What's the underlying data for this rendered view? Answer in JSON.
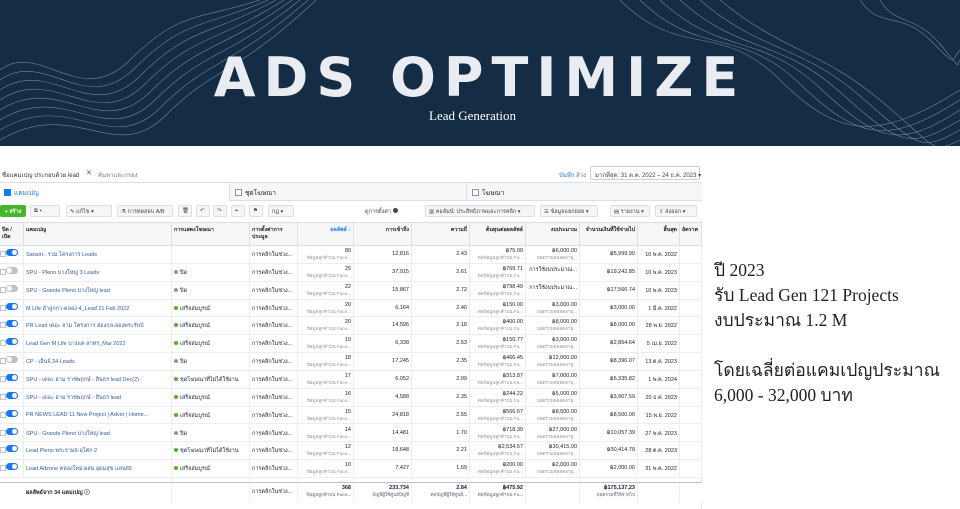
{
  "banner": {
    "title": "ADS OPTIMIZE",
    "subtitle": "Lead Generation"
  },
  "filterbar": {
    "filter_text": "ชื่อแคมเปญ ประกอบด้วย lead",
    "search_placeholder": "ค้นหาและกรอง",
    "save_label": "บันทึก",
    "clear_label": "ล้าง",
    "date_range": "มากที่สุด: 31 ต.ค. 2022 – 24 ธ.ค. 2023"
  },
  "levels": {
    "campaigns": "แคมเปญ",
    "adsets": "ชุดโฆษณา",
    "ads": "โฆษณา"
  },
  "toolbar": {
    "create": "+ สร้าง",
    "edit": "แก้ไข",
    "ab_test": "การทดสอบ A/B",
    "rules": "กฎ",
    "view_setup": "ดูการตั้งค่า",
    "columns": "คอลัมน์: ประสิทธิภาพและการคลิก",
    "breakdown": "ข้อมูลแยกย่อย",
    "reports": "รายงาน",
    "export": "ส่งออก"
  },
  "table": {
    "headers": [
      "ปิด / เปิด",
      "แคมเปญ",
      "การแสดงโฆษณา",
      "การตั้งค่าการประมูล",
      "ผลลัพธ์",
      "การเข้าถึง",
      "ความถี่",
      "ต้นทุนต่อผลลัพธ์",
      "งบประมาณ",
      "จำนวนเงินที่ใช้จ่ายไป",
      "สิ้นสุด",
      "อัตราค"
    ],
    "rows": [
      {
        "on": true,
        "name": "Sansiri - รวม โครงการ Leads",
        "delivery": "",
        "bid": "การคลิกในช่วง...",
        "results": "80",
        "results_sub": "ข้อมูลลูกค้าบน Face...",
        "reach": "12,816",
        "freq": "2.43",
        "cpr": "฿75.00",
        "cpr_sub": "ต่อข้อมูลลูกค้าบน Fa...",
        "budget": "฿6,000.00",
        "budget_sub": "ยอดรวมตลอดอายุ...",
        "spent": "฿5,999.90",
        "end": "10 พ.ค. 2022"
      },
      {
        "on": false,
        "name": "SPU - Pleno บางใหญ่ 3 Leads",
        "delivery": "ปิด",
        "bid": "การคลิกในช่วง...",
        "results": "25",
        "results_sub": "ข้อมูลลูกค้าบน Face...",
        "reach": "37,915",
        "freq": "2.61",
        "cpr": "฿769.71",
        "cpr_sub": "ต่อข้อมูลลูกค้าบน Fa...",
        "budget": "การใช้งบประมาณ...",
        "budget_sub": "",
        "spent": "฿19,242.85",
        "end": "10 พ.ค. 2023"
      },
      {
        "on": false,
        "name": "SPU - Grande Pleno บางใหญ่ lead",
        "delivery": "ปิด",
        "bid": "การคลิกในช่วง...",
        "results": "22",
        "results_sub": "ข้อมูลลูกค้าบน Face...",
        "reach": "15,867",
        "freq": "2.72",
        "cpr": "฿798.49",
        "cpr_sub": "ต่อข้อมูลลูกค้าบน Fa...",
        "budget": "การใช้งบประมาณ...",
        "budget_sub": "",
        "spent": "฿17,566.74",
        "end": "10 พ.ค. 2023"
      },
      {
        "on": true,
        "name": "M Life ลำลูกกา-คลอง 4_Lead 21 Feb 2022",
        "delivery": "เสร็จสมบูรณ์",
        "bid": "การคลิกในช่วง...",
        "results": "20",
        "results_sub": "ข้อมูลลูกค้าบน Face...",
        "reach": "6,164",
        "freq": "2.40",
        "cpr": "฿150.00",
        "cpr_sub": "ต่อข้อมูลลูกค้าบน Fa...",
        "budget": "฿3,000.00",
        "budget_sub": "ยอดรวมตลอดอายุ...",
        "spent": "฿3,000.00",
        "end": "1 มี.ค. 2022"
      },
      {
        "on": true,
        "name": "PR Lead เดอะ ฮาม โครงการ ฮ่องกุล-ลองพระรับบ์",
        "delivery": "เสร็จสมบูรณ์",
        "bid": "การคลิกในช่วง...",
        "results": "20",
        "results_sub": "ข้อมูลลูกค้าบน Face...",
        "reach": "14,596",
        "freq": "2.18",
        "cpr": "฿400.00",
        "cpr_sub": "ต่อข้อมูลลูกค้าบน Fa...",
        "budget": "฿8,000.00",
        "budget_sub": "ยอดรวมตลอดอายุ...",
        "spent": "฿8,000.00",
        "end": "28 พ.ย. 2022"
      },
      {
        "on": true,
        "name": "Lead Gen M Life บางแค สาทร_Mar 2022",
        "delivery": "เสร็จสมบูรณ์",
        "bid": "การคลิกในช่วง...",
        "results": "19",
        "results_sub": "ข้อมูลลูกค้าบน Face...",
        "reach": "6,338",
        "freq": "2.53",
        "cpr": "฿150.77",
        "cpr_sub": "ต่อข้อมูลลูกค้าบน Fa...",
        "budget": "฿3,000.00",
        "budget_sub": "ยอดรวมตลอดอายุ...",
        "spent": "฿2,864.64",
        "end": "5 เม.ย. 2022"
      },
      {
        "on": false,
        "name": "CP - เอ็นจ์ 24 Leads",
        "delivery": "ปิด",
        "bid": "การคลิกในช่วง...",
        "results": "18",
        "results_sub": "ข้อมูลลูกค้าบน Face...",
        "reach": "17,245",
        "freq": "2.35",
        "cpr": "฿466.45",
        "cpr_sub": "ต่อข้อมูลลูกค้าบน Fa...",
        "budget": "฿12,000.00",
        "budget_sub": "ยอดรวมตลอดอายุ...",
        "spent": "฿8,396.07",
        "end": "13 ต.ค. 2023"
      },
      {
        "on": true,
        "name": "SPU - เดอะ ฮาม ราชพฤกษ์ - สินธร lead Dec(2)",
        "delivery": "ชุดโฆษณาที่ไม่ได้ใช้งาน",
        "bid": "การคลิกในช่วง...",
        "results": "17",
        "results_sub": "ข้อมูลลูกค้าบน Face...",
        "reach": "6,052",
        "freq": "2.09",
        "cpr": "฿313.87",
        "cpr_sub": "ต่อข้อมูลลูกค้าบน Fa...",
        "budget": "฿7,000.00",
        "budget_sub": "ยอดรวมตลอดอายุ...",
        "spent": "฿5,335.82",
        "end": "1 พ.ค. 2024"
      },
      {
        "on": true,
        "name": "SPU - เดอะ ฮาม ราชพฤกษ์ - สินธร lead",
        "delivery": "เสร็จสมบูรณ์",
        "bid": "การคลิกในช่วง...",
        "results": "16",
        "results_sub": "ข้อมูลลูกค้าบน Face...",
        "reach": "4,588",
        "freq": "2.35",
        "cpr": "฿244.22",
        "cpr_sub": "ต่อข้อมูลลูกค้าบน Fa...",
        "budget": "฿5,000.00",
        "budget_sub": "ยอดรวมตลอดอายุ...",
        "spent": "฿3,907.59",
        "end": "20 ธ.ค. 2023"
      },
      {
        "on": true,
        "name": "PR NEWS LEAD 11 New Project | Adver | Home...",
        "delivery": "เสร็จสมบูรณ์",
        "bid": "การคลิกในช่วง...",
        "results": "15",
        "results_sub": "ข้อมูลลูกค้าบน Face...",
        "reach": "24,818",
        "freq": "2.55",
        "cpr": "฿566.67",
        "cpr_sub": "ต่อข้อมูลลูกค้าบน Fa...",
        "budget": "฿8,500.00",
        "budget_sub": "ยอดรวมตลอดอายุ...",
        "spent": "฿8,500.00",
        "end": "15 พ.ย. 2022"
      },
      {
        "on": true,
        "name": "SPU - Grande Pleno บางใหญ่ lead",
        "delivery": "ปิด",
        "bid": "การคลิกในช่วง...",
        "results": "14",
        "results_sub": "ข้อมูลลูกค้าบน Face...",
        "reach": "14,481",
        "freq": "1.70",
        "cpr": "฿718.39",
        "cpr_sub": "ต่อข้อมูลลูกค้าบน Fa...",
        "budget": "฿27,000.00",
        "budget_sub": "ยอดรวมตลอดอายุ...",
        "spent": "฿10,057.39",
        "end": "27 พ.ค. 2023"
      },
      {
        "on": true,
        "name": "Lead Pleno พระราม9-อโศก 2",
        "delivery": "ชุดโฆษณาที่ไม่ได้ใช้งาน",
        "bid": "การคลิกในช่วง...",
        "results": "12",
        "results_sub": "ข้อมูลลูกค้าบน Face...",
        "reach": "18,648",
        "freq": "2.21",
        "cpr": "฿2,534.57",
        "cpr_sub": "ต่อข้อมูลลูกค้าบน Fa...",
        "budget": "฿30,415.00",
        "budget_sub": "ยอดรวมตลอดอายุ...",
        "spent": "฿30,414.78",
        "end": "28 ต.ค. 2023"
      },
      {
        "on": true,
        "name": "Lead Adzone คลองใหม่ ผสม อุดมสุข แลน65",
        "delivery": "เสร็จสมบูรณ์",
        "bid": "การคลิกในช่วง...",
        "results": "10",
        "results_sub": "ข้อมูลลูกค้าบน Face...",
        "reach": "7,427",
        "freq": "1.69",
        "cpr": "฿200.00",
        "cpr_sub": "ต่อข้อมูลลูกค้าบน Fa...",
        "budget": "฿2,000.00",
        "budget_sub": "ยอดรวมตลอดอายุ...",
        "spent": "฿2,000.00",
        "end": "31 พ.ค. 2022"
      }
    ],
    "totals": {
      "label": "ผลลัพธ์จาก 34 แคมเปญ",
      "bid": "การคลิกในช่วง...",
      "results": "368",
      "results_sub": "ข้อมูลลูกค้าบน Face...",
      "reach": "233,734",
      "reach_sub": "บัญชีผู้ใช้ศูนย์บัญชี",
      "freq": "2.84",
      "freq_sub": "ต่อบัญชีผู้ใช้ศูนย์...",
      "cpr": "฿475.92",
      "cpr_sub": "ต่อข้อมูลลูกค้าบน Fa...",
      "spent": "฿175,137.23",
      "spent_sub": "ยอดรวมที่ใช้จ่ายไป"
    }
  },
  "info": {
    "line1": "ปี 2023",
    "line2": "รับ Lead Gen 121 Projects",
    "line3": "งบประมาณ 1.2 M",
    "line4": "โดยเฉลี่ยต่อแคมเปญประมาณ",
    "line5": "6,000 - 32,000 บาท"
  },
  "colors": {
    "banner_bg": "#142c44",
    "accent_blue": "#1877f2",
    "create_green": "#42b72a"
  }
}
